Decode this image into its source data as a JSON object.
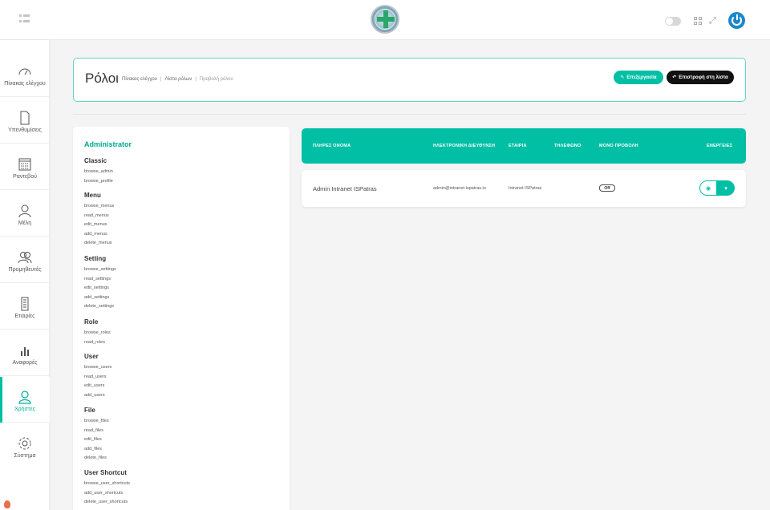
{
  "sidebar": {
    "items": [
      {
        "label": "Πίνακας ελέγχου",
        "icon": "gauge-icon"
      },
      {
        "label": "Υπενθυμίσεις",
        "icon": "document-icon"
      },
      {
        "label": "Ραντεβού",
        "icon": "calendar-icon"
      },
      {
        "label": "Μέλη",
        "icon": "user-icon"
      },
      {
        "label": "Προμηθευτές",
        "icon": "users-icon"
      },
      {
        "label": "Εταιρίες",
        "icon": "building-icon"
      },
      {
        "label": "Αναφορές",
        "icon": "bar-chart-icon"
      },
      {
        "label": "Χρήστες",
        "icon": "user-circle-icon"
      },
      {
        "label": "Σύστημα",
        "icon": "gear-icon"
      }
    ],
    "active_index": 7
  },
  "header": {
    "title": "Ρόλοι",
    "breadcrumb": [
      "Πίνακας ελέγχου",
      "Λίστα ρόλων",
      "Προβολή ρόλου"
    ],
    "edit_label": "Επεξεργασία",
    "back_label": "Επιστροφή στη λίστα"
  },
  "role": {
    "name": "Administrator",
    "groups": [
      {
        "title": "Classic",
        "perms": [
          "browse_admin",
          "browse_profile"
        ]
      },
      {
        "title": "Menu",
        "perms": [
          "browse_menus",
          "read_menus",
          "edit_menus",
          "add_menus",
          "delete_menus"
        ]
      },
      {
        "title": "Setting",
        "perms": [
          "browse_settings",
          "read_settings",
          "edit_settings",
          "add_settings",
          "delete_settings"
        ]
      },
      {
        "title": "Role",
        "perms": [
          "browse_roles",
          "read_roles"
        ]
      },
      {
        "title": "User",
        "perms": [
          "browse_users",
          "read_users",
          "edit_users",
          "add_users"
        ]
      },
      {
        "title": "File",
        "perms": [
          "browse_files",
          "read_files",
          "edit_files",
          "add_files",
          "delete_files"
        ]
      },
      {
        "title": "User Shortcut",
        "perms": [
          "browse_user_shortcuts",
          "add_user_shortcuts",
          "delete_user_shortcuts"
        ]
      }
    ]
  },
  "table": {
    "headers": {
      "name": "ΠΛΗΡΕΣ ΟΝΟΜΑ",
      "email": "ΗΛΕΚΤΡΟΝΙΚΗ ΔΙΕΥΘΥΝΣΗ",
      "company": "ΕΤΑΙΡΙΑ",
      "phone": "ΤΗΛΕΦΩΝΟ",
      "view_only": "ΜΟΝΟ ΠΡΟΒΟΛΗ",
      "actions": "ΕΝΕΡΓΕΙΕΣ"
    },
    "rows": [
      {
        "name": "Admin Intranet ISPatras",
        "email": "admin@intranet-ispatras.io",
        "company": "Intranet ISPatras",
        "phone": "",
        "view_only": "Off"
      }
    ]
  },
  "colors": {
    "accent": "#00bfa5",
    "dark": "#111111",
    "power": "#1b88c9"
  }
}
